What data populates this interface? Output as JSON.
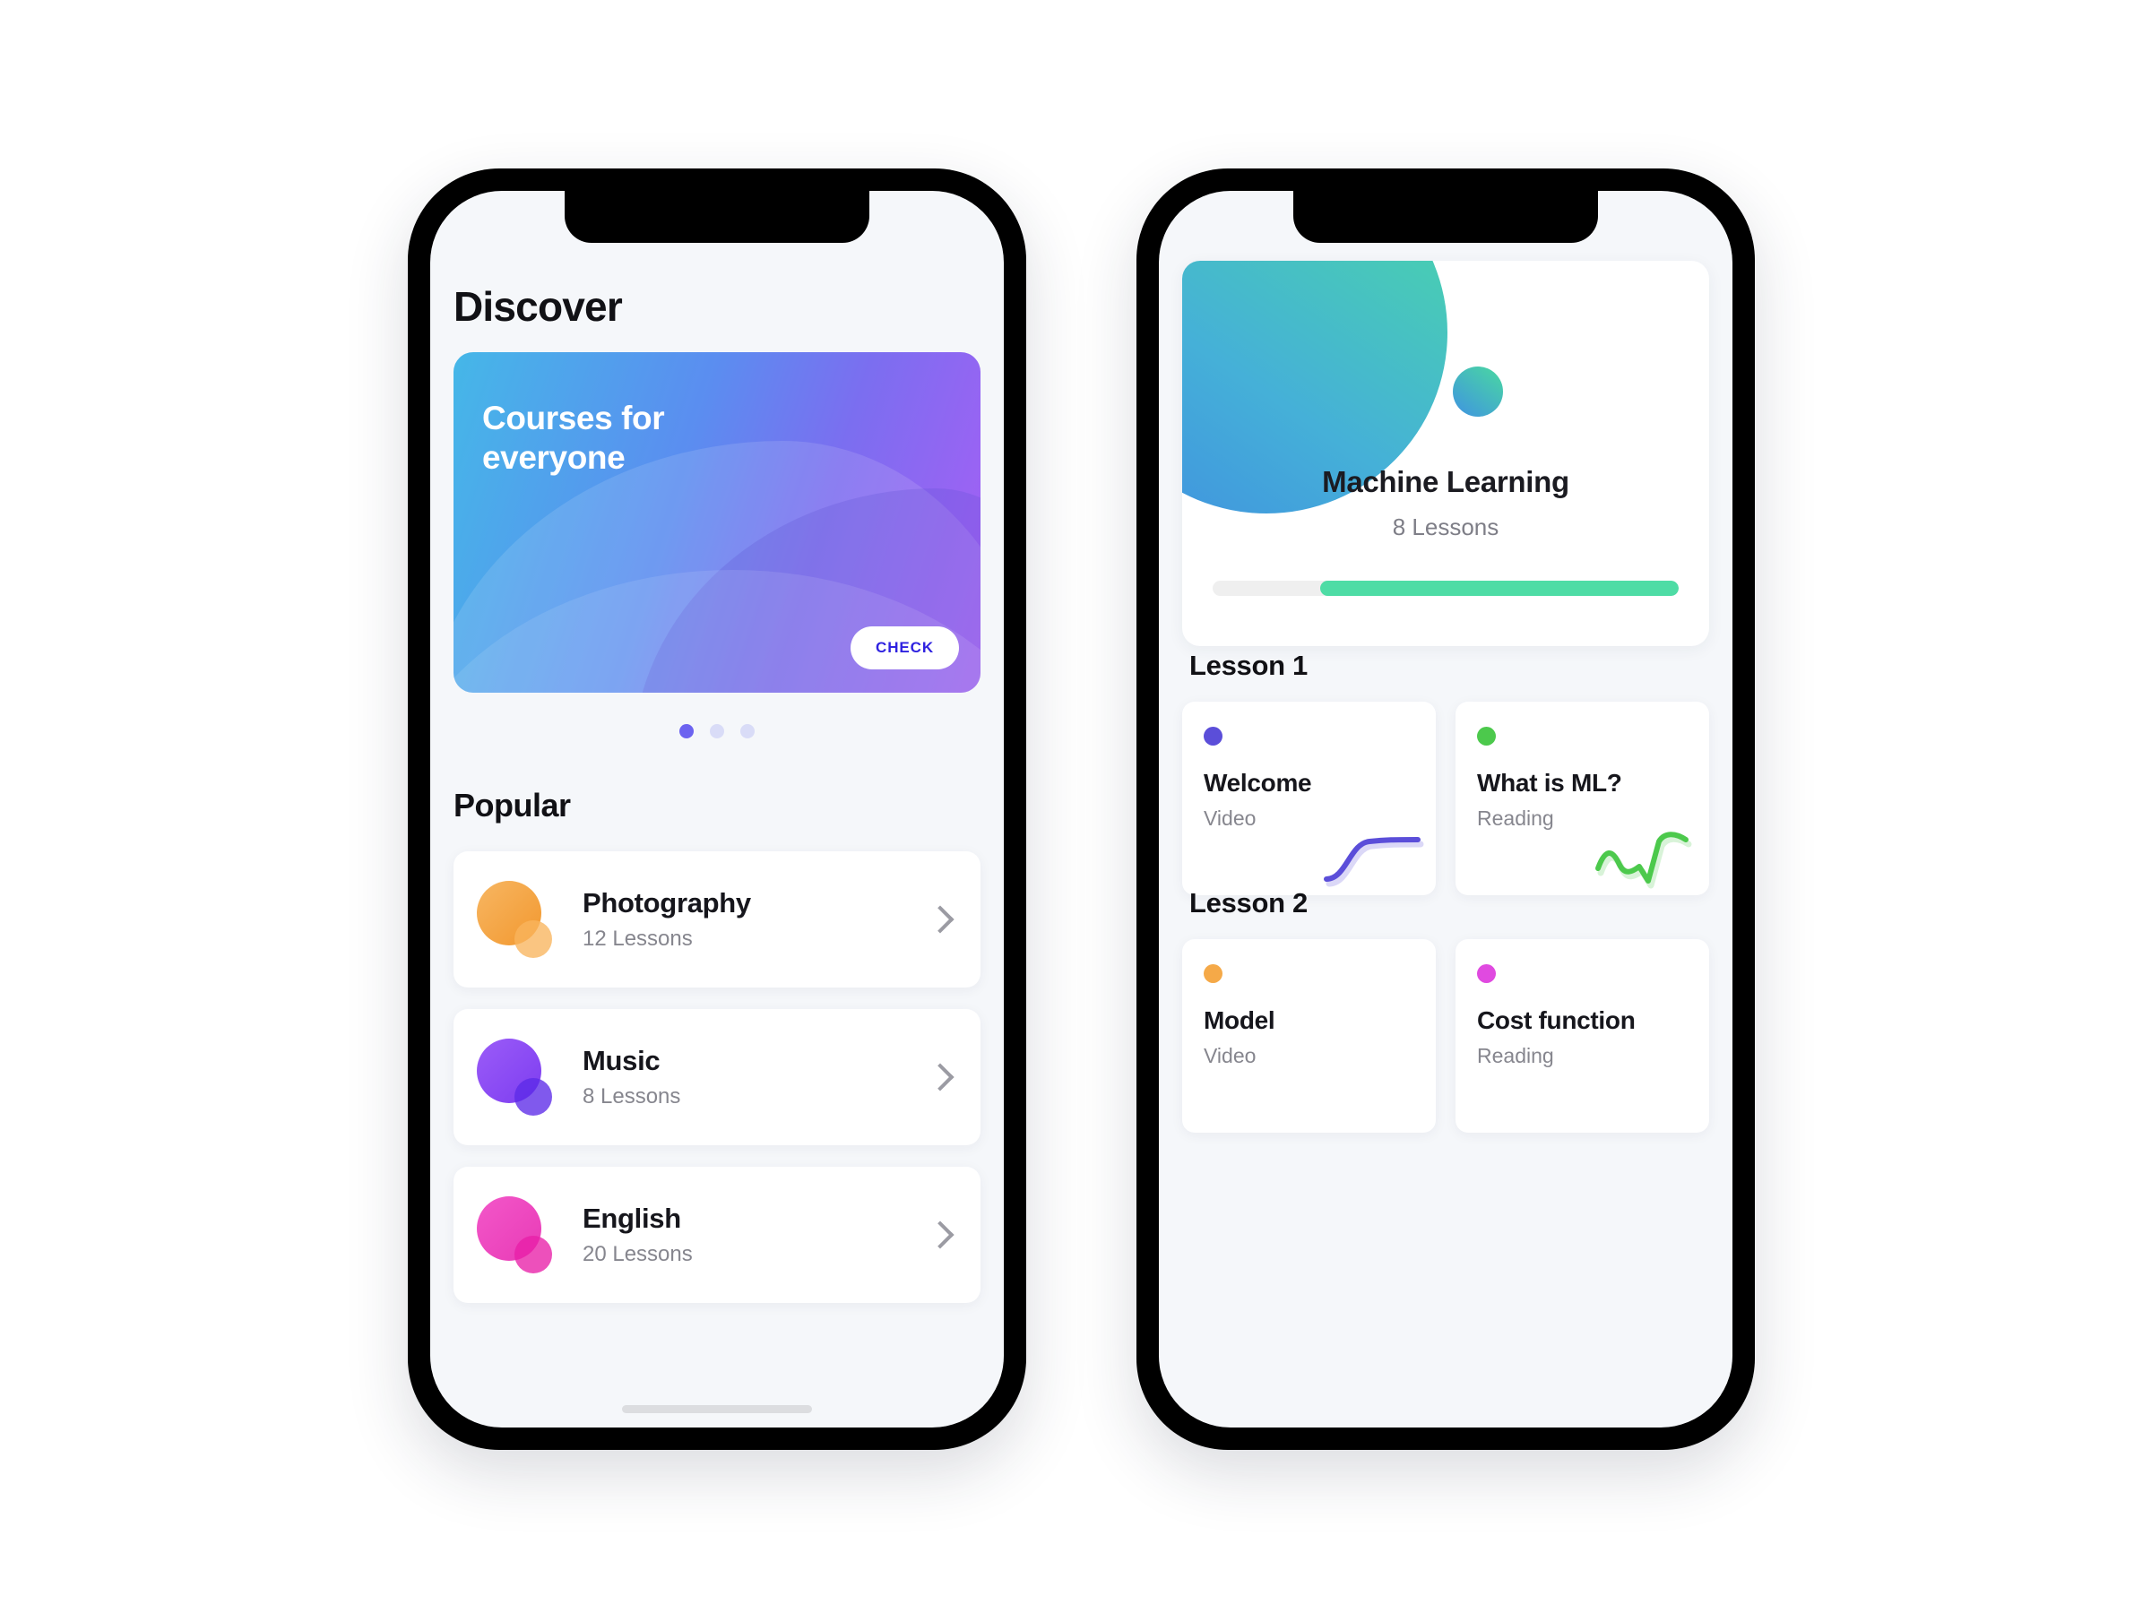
{
  "screens": [
    {
      "name": "discover",
      "title": "Discover",
      "hero": {
        "headline": "Courses for everyone",
        "cta_label": "CHECK",
        "gradient_from": "#45b7e8",
        "gradient_to": "#a95ef5",
        "cta_text_color": "#2f22e0"
      },
      "carousel": {
        "total_dots": 3,
        "active_index": 0,
        "active_color": "#6c63f0",
        "inactive_color": "#d9dcf7"
      },
      "popular": {
        "section_label": "Popular",
        "courses": [
          {
            "name": "Photography",
            "lessons": "12 Lessons",
            "color": "#f5a948",
            "color_small": "#f8bb66",
            "chevron": "chevron-right-icon"
          },
          {
            "name": "Music",
            "lessons": "8 Lessons",
            "color": "#8c4ef5",
            "color_small": "#5c2ae8",
            "chevron": "chevron-right-icon"
          },
          {
            "name": "English",
            "lessons": "20 Lessons",
            "color": "#ec4bc8",
            "color_small": "#e81fa8",
            "chevron": "chevron-right-icon"
          }
        ]
      }
    },
    {
      "name": "course-detail",
      "course": {
        "title": "Machine Learning",
        "lessons": "8 Lessons",
        "progress_percent": 77,
        "progress_color": "#4edca5",
        "progress_track_color": "#efefef",
        "blob_gradient_from": "#3f8fe0",
        "blob_gradient_to": "#4ad9a4"
      },
      "lessons": [
        {
          "heading": "Lesson 1",
          "items": [
            {
              "title": "Welcome",
              "type": "Video",
              "dot_color": "#5b4ed9",
              "squiggle": "s-curve-squiggle",
              "squiggle_color": "#5b4ed9"
            },
            {
              "title": "What is ML?",
              "type": "Reading",
              "dot_color": "#4cc94c",
              "squiggle": "zigzag-squiggle",
              "squiggle_color": "#4cc94c"
            }
          ]
        },
        {
          "heading": "Lesson 2",
          "items": [
            {
              "title": "Model",
              "type": "Video",
              "dot_color": "#f5a948",
              "squiggle": "none",
              "squiggle_color": "#f5a948"
            },
            {
              "title": "Cost function",
              "type": "Reading",
              "dot_color": "#e04ae0",
              "squiggle": "none",
              "squiggle_color": "#e04ae0"
            }
          ]
        }
      ]
    }
  ]
}
